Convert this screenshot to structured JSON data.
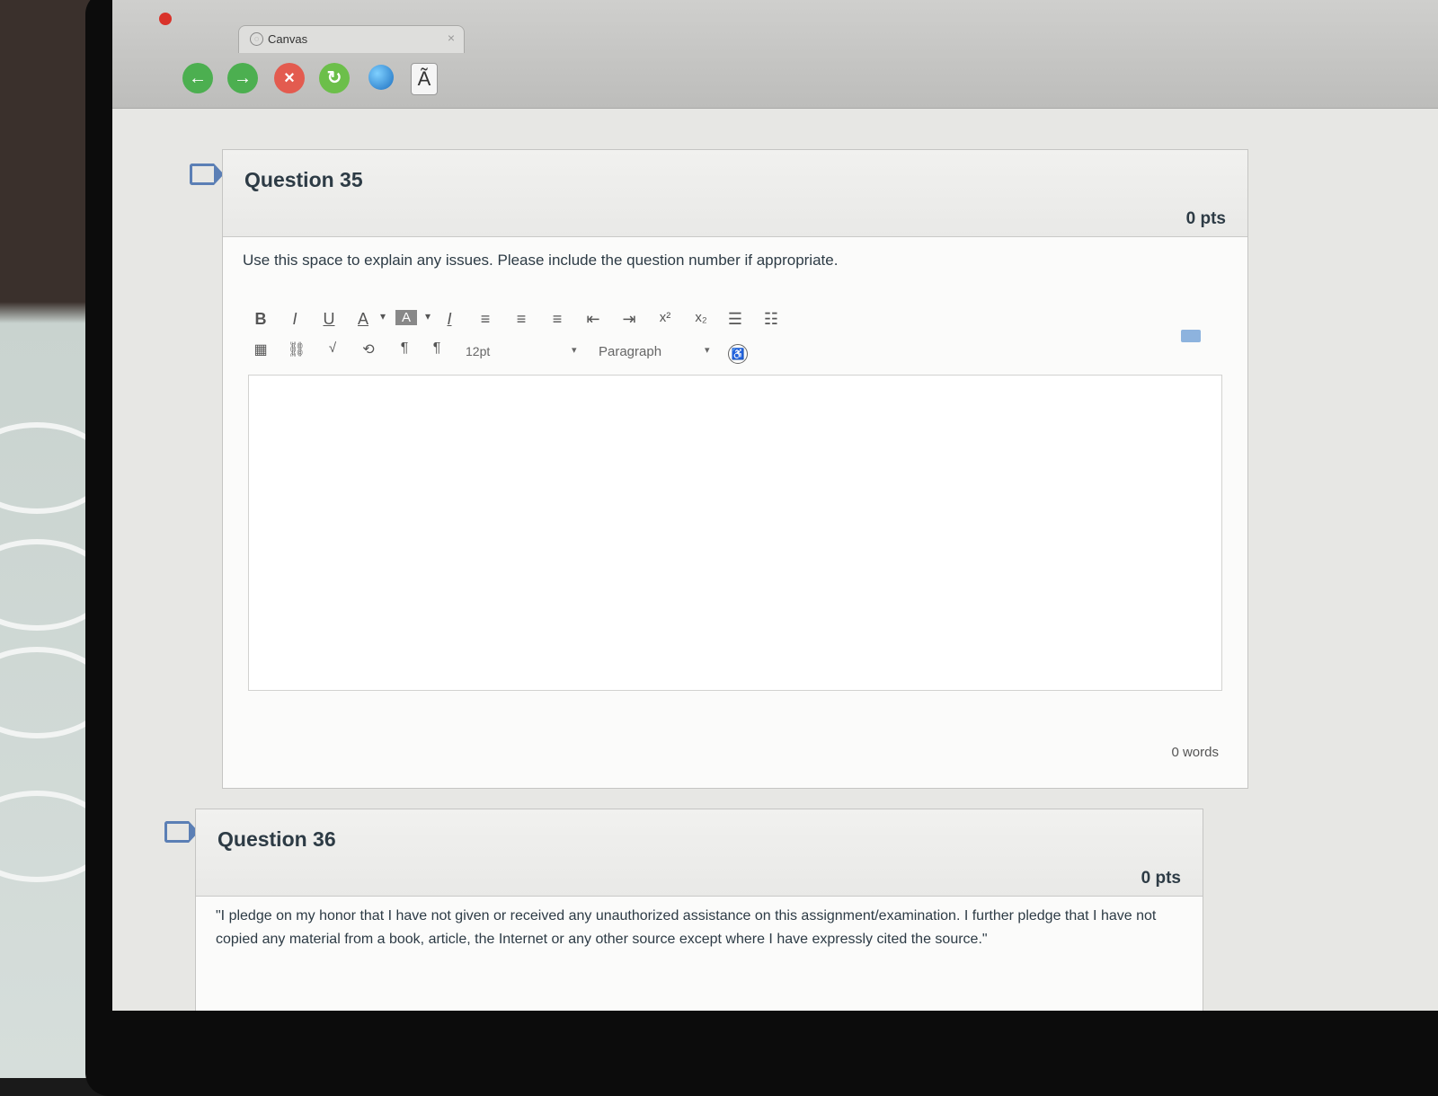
{
  "browser": {
    "tab_title": "Canvas",
    "tab_close": "×",
    "tab_icon": "canvas-favicon",
    "text_size_button": "Ã"
  },
  "toolbar": {
    "bold": "B",
    "italic": "I",
    "underline": "U",
    "font_color": "A",
    "bg_color": "A",
    "clear_format": "I",
    "superscript": "x²",
    "subscript": "x₂",
    "font_size": "12pt",
    "block_format": "Paragraph",
    "dropdown_arrow": "▾"
  },
  "questions": [
    {
      "title": "Question 35",
      "points": "0 pts",
      "prompt": "Use this space to explain any issues. Please include the question number if appropriate.",
      "word_count": "0 words"
    },
    {
      "title": "Question 36",
      "points": "0 pts",
      "prompt": "\"I pledge on my honor that I have not given or received any unauthorized assistance on this assignment/examination. I further pledge that I have not copied any material from a book, article, the Internet or any other source except where I have expressly cited the source.\""
    }
  ],
  "colors": {
    "accent_blue": "#5b7fb5",
    "text": "#2d3b45",
    "close_red": "#d9322a",
    "nav_green": "#4caf50"
  }
}
